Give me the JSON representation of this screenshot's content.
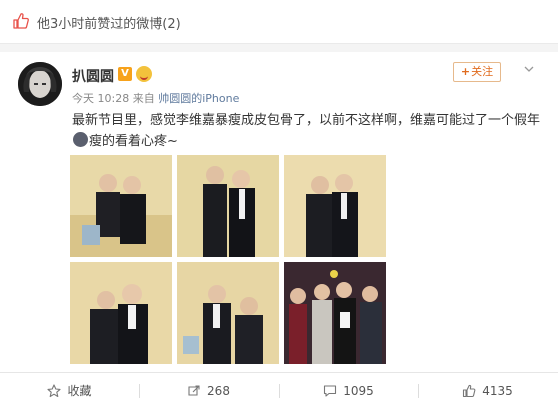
{
  "liked_bar": {
    "text": "他3小时前赞过的微博(2)"
  },
  "post": {
    "username": "扒圆圆",
    "vip_badge": "V",
    "timestamp": "今天 10:28",
    "source_prefix": "来自",
    "device": "帅圆圆的iPhone",
    "follow_label": "关注",
    "follow_plus": "+",
    "text_before_emoji": "最新节目里，感觉李维嘉暴瘦成皮包骨了，以前不这样啊，维嘉可能过了一个假年",
    "text_after_emoji": "瘦的看着心疼~"
  },
  "photos": [
    {
      "name": "photo-1"
    },
    {
      "name": "photo-2"
    },
    {
      "name": "photo-3"
    },
    {
      "name": "photo-4"
    },
    {
      "name": "photo-5"
    },
    {
      "name": "photo-6"
    }
  ],
  "actions": {
    "favorite": "收藏",
    "repost": "268",
    "comment": "1095",
    "like": "4135"
  },
  "colors": {
    "accent_orange": "#e06b1e",
    "link_blue": "#5f7a9d",
    "vip_orange": "#f7a21b"
  },
  "icons": [
    "thumbs-up-icon",
    "chevron-down-icon",
    "star-icon",
    "repost-icon",
    "comment-icon",
    "like-icon"
  ]
}
